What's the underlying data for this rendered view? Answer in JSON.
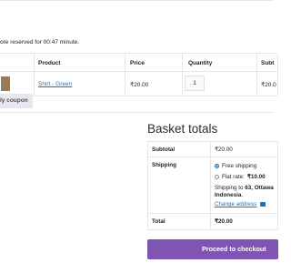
{
  "notice": {
    "text": "ore reserved for 00:47 minute."
  },
  "cart": {
    "columns": {
      "product": "Product",
      "price": "Price",
      "quantity": "Quantity",
      "subtotal": "Subt"
    },
    "items": [
      {
        "product": "Shirt - Green",
        "price": "₹20.00",
        "quantity": "1",
        "subtotal": "₹20.0"
      }
    ]
  },
  "coupon": {
    "label": "ly coupon"
  },
  "totals": {
    "title": "Basket totals",
    "subtotal_label": "Subtotal",
    "subtotal_value": "₹20.00",
    "shipping_label": "Shipping",
    "shipping_options": [
      {
        "label": "Free shipping",
        "selected": true
      },
      {
        "label": "Flat rate:",
        "price": "₹10.00",
        "selected": false
      }
    ],
    "shipping_to_line1_prefix": "Shipping to ",
    "shipping_to_line1_bold": "63, Ottawa",
    "shipping_to_line2": "Indonesia",
    "shipping_to_line2_suffix": ".",
    "change_address": "Change address",
    "total_label": "Total",
    "total_value": "₹20.00"
  },
  "checkout": {
    "label": "Proceed to checkout"
  },
  "colors": {
    "accent": "#7f54b3",
    "link": "#2271b1",
    "border": "#e6e6e6"
  }
}
